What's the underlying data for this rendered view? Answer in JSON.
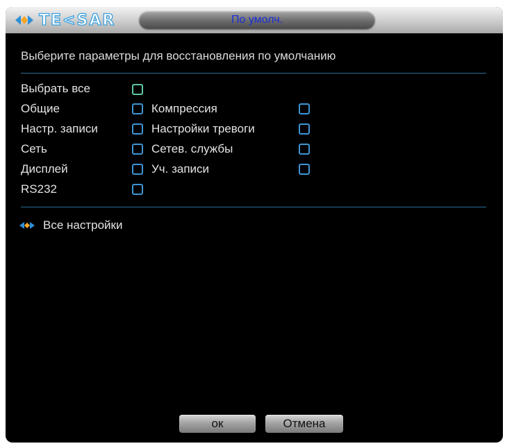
{
  "window": {
    "logo_text": "TE<SAR",
    "title": "По умолч."
  },
  "header": {
    "instruction": "Выберите параметры для восстановления по умолчанию"
  },
  "options": {
    "select_all": {
      "label": "Выбрать все",
      "checked": false
    },
    "left": [
      {
        "label": "Общие",
        "checked": false
      },
      {
        "label": "Настр. записи",
        "checked": false
      },
      {
        "label": "Сеть",
        "checked": false
      },
      {
        "label": "Дисплей",
        "checked": false
      },
      {
        "label": "RS232",
        "checked": false
      }
    ],
    "right": [
      {
        "label": "Компрессия",
        "checked": false
      },
      {
        "label": "Настройки тревоги",
        "checked": false
      },
      {
        "label": "Сетев. службы",
        "checked": false
      },
      {
        "label": "Уч. записи",
        "checked": false
      }
    ]
  },
  "all_settings": {
    "label": "Все настройки",
    "icon": "double-arrow-icon"
  },
  "buttons": {
    "ok": "ок",
    "cancel": "Отмена"
  },
  "colors": {
    "background": "#000000",
    "title_text": "#1a2fd8",
    "checkbox_border": "#3f95d4",
    "select_all_border": "#5ec9a4",
    "divider": "#2f6f9a"
  }
}
